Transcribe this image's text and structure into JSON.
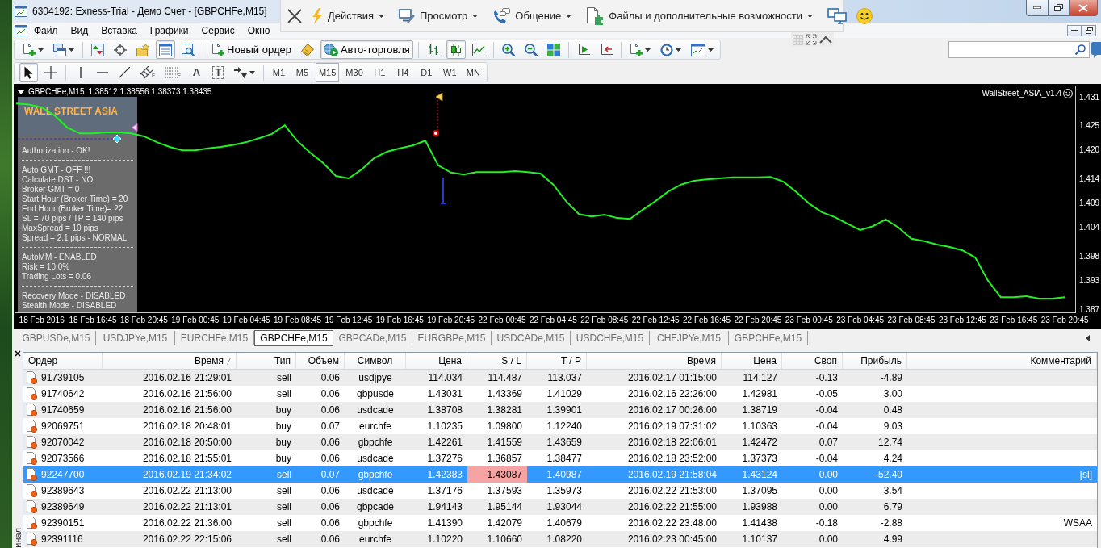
{
  "window": {
    "title": "6304192: Exness-Trial - Демо Счет - [GBPCHFe,M15]"
  },
  "remote_toolbar": {
    "menus": [
      {
        "kind": "actions",
        "label": "Действия"
      },
      {
        "kind": "view",
        "label": "Просмотр"
      },
      {
        "kind": "communication",
        "label": "Общение"
      },
      {
        "kind": "files",
        "label": "Файлы и дополнительные возможности"
      }
    ]
  },
  "menu_bar": {
    "items": [
      "Файл",
      "Вид",
      "Вставка",
      "Графики",
      "Сервис",
      "Окно"
    ]
  },
  "toolbar_main": {
    "groups": [
      [
        {
          "kind": "new-chart",
          "dropdown": true,
          "pressed": false
        },
        {
          "kind": "profiles",
          "dropdown": true,
          "pressed": false
        }
      ],
      [
        {
          "kind": "market-watch",
          "dropdown": false,
          "pressed": false
        },
        {
          "kind": "data-window",
          "dropdown": false,
          "pressed": false
        },
        {
          "kind": "navigator",
          "dropdown": false,
          "pressed": false
        },
        {
          "kind": "terminal",
          "dropdown": false,
          "pressed": true
        },
        {
          "kind": "tester",
          "dropdown": false,
          "pressed": false
        }
      ],
      [
        {
          "kind": "new-order",
          "label": "Новый ордер",
          "dropdown": false,
          "pressed": false
        },
        {
          "kind": "editor",
          "dropdown": false,
          "pressed": false
        },
        {
          "kind": "autotrading",
          "label": "Авто-торговля",
          "dropdown": false,
          "pressed": true
        }
      ],
      [
        {
          "kind": "bar-chart",
          "dropdown": false,
          "pressed": false
        },
        {
          "kind": "candles",
          "dropdown": false,
          "pressed": true
        },
        {
          "kind": "line-chart",
          "dropdown": false,
          "pressed": false
        }
      ],
      [
        {
          "kind": "zoom-in",
          "dropdown": false,
          "pressed": false
        },
        {
          "kind": "zoom-out",
          "dropdown": false,
          "pressed": false
        },
        {
          "kind": "tile",
          "dropdown": false,
          "pressed": false
        }
      ],
      [
        {
          "kind": "autoscroll",
          "dropdown": false,
          "pressed": false
        },
        {
          "kind": "chart-shift",
          "dropdown": false,
          "pressed": false
        }
      ],
      [
        {
          "kind": "indicators",
          "dropdown": true,
          "pressed": false
        },
        {
          "kind": "periods",
          "dropdown": true,
          "pressed": false
        },
        {
          "kind": "templates",
          "dropdown": true,
          "pressed": false
        }
      ]
    ]
  },
  "toolbar_draw": {
    "groups": [
      [
        {
          "kind": "cursor",
          "dropdown": false,
          "pressed": true
        },
        {
          "kind": "crosshair",
          "dropdown": false,
          "pressed": false
        }
      ],
      [
        {
          "kind": "vline",
          "dropdown": false,
          "pressed": false
        },
        {
          "kind": "hline",
          "dropdown": false,
          "pressed": false
        },
        {
          "kind": "trendline",
          "dropdown": false,
          "pressed": false
        },
        {
          "kind": "fibo-channel",
          "glyph": "E",
          "dropdown": false,
          "pressed": false
        },
        {
          "kind": "fibo",
          "glyph": "F",
          "dropdown": false,
          "pressed": false
        },
        {
          "kind": "text",
          "glyph": "A",
          "dropdown": false,
          "pressed": false
        },
        {
          "kind": "label",
          "glyph": "T",
          "dropdown": false,
          "pressed": false
        },
        {
          "kind": "arrows",
          "dropdown": true,
          "pressed": false
        }
      ]
    ],
    "timeframes": [
      {
        "label": "M1",
        "selected": false
      },
      {
        "label": "M5",
        "selected": false
      },
      {
        "label": "M15",
        "selected": true
      },
      {
        "label": "M30",
        "selected": false
      },
      {
        "label": "H1",
        "selected": false
      },
      {
        "label": "H4",
        "selected": false
      },
      {
        "label": "D1",
        "selected": false
      },
      {
        "label": "W1",
        "selected": false
      },
      {
        "label": "MN",
        "selected": false
      }
    ]
  },
  "chart": {
    "header_prices": "1.38512 1.38556 1.38373 1.38435",
    "expert": "WallStreet_ASIA_v1.4",
    "ea_panel": {
      "title": "WALL STREET ASIA",
      "sections": [
        [
          "Authorization - OK!"
        ],
        [
          "Auto GMT - OFF !!!",
          "Calculate DST - NO",
          "Broker GMT = 0",
          "Start Hour (Broker Time) = 20",
          "End Hour (Broker Time)= 22",
          "SL = 70 pips / TP = 140 pips",
          "MaxSpread = 10 pips",
          "Spread = 2.1 pips - NORMAL"
        ],
        [
          "AutoMM - ENABLED",
          "Risk = 10.0%",
          "Trading Lots = 0.06"
        ],
        [
          "Recovery Mode - DISABLED",
          "Stealth Mode - DISABLED"
        ]
      ]
    },
    "chart_data": {
      "type": "line",
      "categories": [
        null,
        null,
        "18 Feb 2016",
        null,
        null,
        null,
        "18 Feb 16:45",
        null,
        null,
        null,
        "18 Feb 20:45",
        null,
        null,
        null,
        "19 Feb 00:45",
        null,
        null,
        null,
        "19 Feb 04:45",
        null,
        null,
        null,
        "19 Feb 08:45",
        null,
        null,
        null,
        "19 Feb 12:45",
        null,
        null,
        null,
        "19 Feb 16:45",
        null,
        null,
        null,
        "19 Feb 20:45",
        null,
        null,
        null,
        "22 Feb 00:45",
        null,
        null,
        null,
        "22 Feb 04:45",
        null,
        null,
        null,
        "22 Feb 08:45",
        null,
        null,
        null,
        "22 Feb 12:45",
        null,
        null,
        null,
        "22 Feb 16:45",
        null,
        null,
        null,
        "22 Feb 20:45",
        null,
        null,
        null,
        "23 Feb 00:45",
        null,
        null,
        null,
        "23 Feb 04:45",
        null,
        null,
        null,
        "23 Feb 08:45",
        null,
        null,
        null,
        "23 Feb 12:45",
        null,
        null,
        null,
        "23 Feb 16:45",
        null,
        null,
        null,
        "23 Feb 20:45"
      ],
      "series": [
        {
          "name": "GBPCHFe,M15",
          "color": "#22f022",
          "values": [
            1.4299,
            1.4297,
            1.4291,
            1.4274,
            1.4249,
            1.4237,
            1.4237,
            1.4239,
            1.4239,
            1.4237,
            1.4231,
            1.4219,
            1.4209,
            1.4202,
            1.4202,
            1.4206,
            1.4209,
            1.4213,
            1.4219,
            1.4227,
            1.4236,
            1.4254,
            1.4221,
            1.4197,
            1.4176,
            1.4149,
            1.4144,
            1.4162,
            1.4186,
            1.4199,
            1.4206,
            1.4212,
            1.4222,
            1.4171,
            1.4156,
            1.4152,
            1.4157,
            1.4157,
            1.4157,
            1.4159,
            1.4157,
            1.4154,
            1.4131,
            1.4097,
            1.407,
            1.4065,
            1.4069,
            1.4062,
            1.406,
            1.4079,
            1.4097,
            1.4117,
            1.4131,
            1.4139,
            1.4142,
            1.4144,
            1.4146,
            1.4146,
            1.4146,
            1.4147,
            1.4137,
            1.4116,
            1.4092,
            1.4074,
            1.4064,
            1.405,
            1.4037,
            1.4045,
            1.4059,
            1.4042,
            1.4019,
            1.4014,
            1.4007,
            1.4002,
            1.3995,
            1.398,
            1.3932,
            1.3898,
            1.3898,
            1.39,
            1.3895,
            1.3895,
            1.3898
          ]
        }
      ],
      "ylim": [
        1.3865,
        1.4336
      ],
      "yticks": [
        {
          "value": 1.431,
          "label": "1.431"
        },
        {
          "value": 1.425,
          "label": "1.425"
        },
        {
          "value": 1.42,
          "label": "1.420"
        },
        {
          "value": 1.414,
          "label": "1.414"
        },
        {
          "value": 1.409,
          "label": "1.409"
        },
        {
          "value": 1.404,
          "label": "1.404"
        },
        {
          "value": 1.398,
          "label": "1.398"
        },
        {
          "value": 1.393,
          "label": "1.393"
        },
        {
          "value": 1.387,
          "label": "1.387"
        }
      ]
    }
  },
  "chart_tabs": [
    {
      "label": "GBPUSDe,M15",
      "selected": false
    },
    {
      "label": "USDJPYe,M15",
      "selected": false
    },
    {
      "label": "EURCHFe,M15",
      "selected": false
    },
    {
      "label": "GBPCHFe,M15",
      "selected": true
    },
    {
      "label": "GBPCADe,M15",
      "selected": false
    },
    {
      "label": "EURGBPe,M15",
      "selected": false
    },
    {
      "label": "USDCADe,M15",
      "selected": false
    },
    {
      "label": "USDCHFe,M15",
      "selected": false
    },
    {
      "label": "CHFJPYe,M15",
      "selected": false
    },
    {
      "label": "GBPCHFe,M15",
      "selected": false
    }
  ],
  "terminal": {
    "side_label": "инал",
    "columns": [
      {
        "label": "Ордер",
        "sorted": false
      },
      {
        "label": "Время",
        "sorted": true
      },
      {
        "label": "Тип",
        "sorted": false
      },
      {
        "label": "Объем",
        "sorted": false
      },
      {
        "label": "Символ",
        "sorted": false
      },
      {
        "label": "Цена",
        "sorted": false
      },
      {
        "label": "S / L",
        "sorted": false
      },
      {
        "label": "T / P",
        "sorted": false
      },
      {
        "label": "Время",
        "sorted": false
      },
      {
        "label": "Цена",
        "sorted": false
      },
      {
        "label": "Своп",
        "sorted": false
      },
      {
        "label": "Прибыль",
        "sorted": false
      },
      {
        "label": "Комментарий",
        "sorted": false
      }
    ],
    "rows": [
      {
        "order": "91739105",
        "open_time": "2016.02.16 21:29:01",
        "type": "sell",
        "volume": "0.06",
        "symbol": "usdjpye",
        "open_price": "114.034",
        "sl": "114.487",
        "tp": "113.037",
        "close_time": "2016.02.17 01:15:00",
        "close_price": "114.127",
        "swap": "-0.13",
        "profit": "-4.89",
        "selected": false,
        "sl_hit": false
      },
      {
        "order": "91740642",
        "open_time": "2016.02.16 21:56:00",
        "type": "sell",
        "volume": "0.06",
        "symbol": "gbpusde",
        "open_price": "1.43031",
        "sl": "1.43369",
        "tp": "1.41029",
        "close_time": "2016.02.16 22:26:00",
        "close_price": "1.42981",
        "swap": "-0.05",
        "profit": "3.00",
        "selected": false,
        "sl_hit": false
      },
      {
        "order": "91740659",
        "open_time": "2016.02.16 21:56:00",
        "type": "buy",
        "volume": "0.06",
        "symbol": "usdcade",
        "open_price": "1.38708",
        "sl": "1.38281",
        "tp": "1.39901",
        "close_time": "2016.02.17 00:26:00",
        "close_price": "1.38719",
        "swap": "-0.04",
        "profit": "0.48",
        "selected": false,
        "sl_hit": false
      },
      {
        "order": "92069751",
        "open_time": "2016.02.18 20:48:01",
        "type": "buy",
        "volume": "0.07",
        "symbol": "eurchfe",
        "open_price": "1.10235",
        "sl": "1.09800",
        "tp": "1.12240",
        "close_time": "2016.02.19 07:31:02",
        "close_price": "1.10363",
        "swap": "-0.04",
        "profit": "9.03",
        "selected": false,
        "sl_hit": false
      },
      {
        "order": "92070042",
        "open_time": "2016.02.18 20:50:00",
        "type": "buy",
        "volume": "0.06",
        "symbol": "gbpchfe",
        "open_price": "1.42261",
        "sl": "1.41559",
        "tp": "1.43659",
        "close_time": "2016.02.18 22:06:01",
        "close_price": "1.42472",
        "swap": "0.07",
        "profit": "12.74",
        "selected": false,
        "sl_hit": false
      },
      {
        "order": "92073566",
        "open_time": "2016.02.18 21:55:01",
        "type": "buy",
        "volume": "0.06",
        "symbol": "usdcade",
        "open_price": "1.37276",
        "sl": "1.36857",
        "tp": "1.38477",
        "close_time": "2016.02.18 23:52:00",
        "close_price": "1.37373",
        "swap": "-0.04",
        "profit": "4.24",
        "selected": false,
        "sl_hit": false
      },
      {
        "order": "92247700",
        "open_time": "2016.02.19 21:34:02",
        "type": "sell",
        "volume": "0.07",
        "symbol": "gbpchfe",
        "open_price": "1.42383",
        "sl": "1.43087",
        "tp": "1.40987",
        "close_time": "2016.02.19 21:58:04",
        "close_price": "1.43124",
        "swap": "0.00",
        "profit": "-52.40",
        "comment": "[sl]",
        "selected": true,
        "sl_hit": true
      },
      {
        "order": "92389643",
        "open_time": "2016.02.22 21:13:00",
        "type": "sell",
        "volume": "0.06",
        "symbol": "usdcade",
        "open_price": "1.37176",
        "sl": "1.37593",
        "tp": "1.35973",
        "close_time": "2016.02.22 21:53:00",
        "close_price": "1.37095",
        "swap": "0.00",
        "profit": "3.54",
        "selected": false,
        "sl_hit": false
      },
      {
        "order": "92389649",
        "open_time": "2016.02.22 21:13:01",
        "type": "sell",
        "volume": "0.06",
        "symbol": "gbpcade",
        "open_price": "1.94143",
        "sl": "1.95144",
        "tp": "1.93044",
        "close_time": "2016.02.22 21:55:00",
        "close_price": "1.93988",
        "swap": "0.00",
        "profit": "6.79",
        "selected": false,
        "sl_hit": false
      },
      {
        "order": "92390151",
        "open_time": "2016.02.22 21:36:00",
        "type": "sell",
        "volume": "0.06",
        "symbol": "gbpchfe",
        "open_price": "1.41390",
        "sl": "1.42079",
        "tp": "1.40679",
        "close_time": "2016.02.22 23:48:00",
        "close_price": "1.41438",
        "swap": "-0.18",
        "profit": "-2.88",
        "comment": "WSAA",
        "selected": false,
        "sl_hit": false
      },
      {
        "order": "92391116",
        "open_time": "2016.02.22 22:15:06",
        "type": "sell",
        "volume": "0.06",
        "symbol": "eurchfe",
        "open_price": "1.10220",
        "sl": "1.10660",
        "tp": "1.08220",
        "close_time": "2016.02.23 00:45:00",
        "close_price": "1.10137",
        "swap": "0.00",
        "profit": "4.99",
        "selected": false,
        "sl_hit": false
      }
    ]
  }
}
